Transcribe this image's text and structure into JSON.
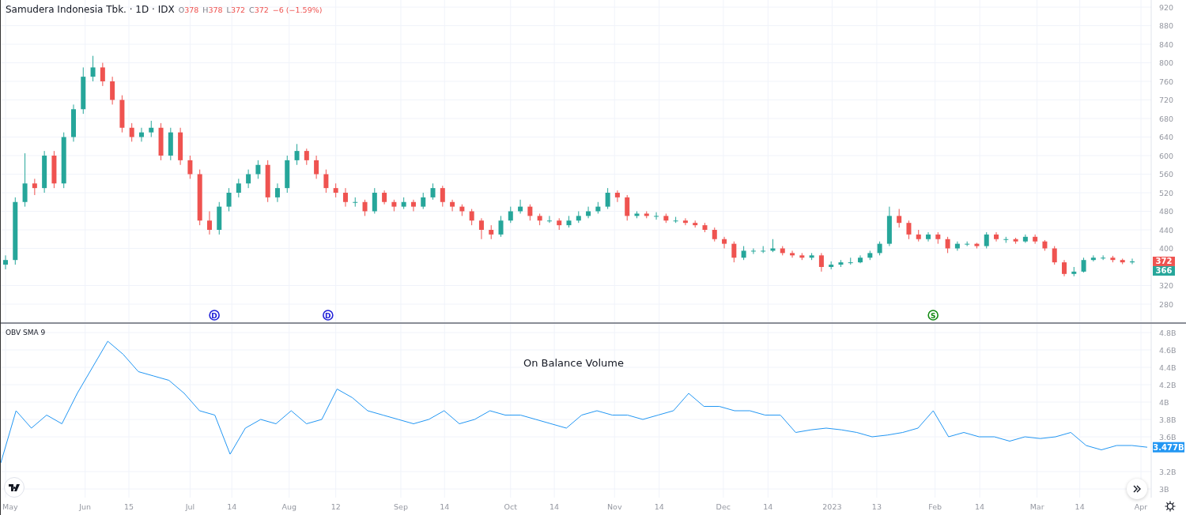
{
  "header": {
    "title": "Samudera Indonesia Tbk. · 1D · IDX",
    "ohlc": [
      {
        "label": "O",
        "value": "378"
      },
      {
        "label": "H",
        "value": "378"
      },
      {
        "label": "L",
        "value": "372"
      },
      {
        "label": "C",
        "value": "372"
      }
    ],
    "change": "−6 (−1.59%)"
  },
  "price_chart": {
    "chart_data": {
      "type": "candlestick",
      "grid": true,
      "ylim": [
        280,
        920
      ],
      "yticks": [
        280,
        320,
        400,
        440,
        480,
        520,
        560,
        600,
        640,
        680,
        720,
        760,
        800,
        840,
        880,
        920
      ],
      "ohlc": [
        [
          365,
          385,
          355,
          375
        ],
        [
          375,
          510,
          365,
          500
        ],
        [
          500,
          605,
          490,
          540
        ],
        [
          540,
          550,
          515,
          530
        ],
        [
          530,
          610,
          520,
          600
        ],
        [
          600,
          610,
          530,
          540
        ],
        [
          540,
          650,
          530,
          640
        ],
        [
          640,
          710,
          630,
          700
        ],
        [
          700,
          790,
          690,
          770
        ],
        [
          770,
          815,
          760,
          790
        ],
        [
          790,
          800,
          750,
          760
        ],
        [
          760,
          770,
          710,
          720
        ],
        [
          720,
          730,
          650,
          660
        ],
        [
          660,
          670,
          630,
          640
        ],
        [
          640,
          660,
          630,
          650
        ],
        [
          650,
          675,
          640,
          660
        ],
        [
          660,
          670,
          590,
          600
        ],
        [
          600,
          660,
          590,
          650
        ],
        [
          650,
          660,
          580,
          590
        ],
        [
          590,
          600,
          550,
          560
        ],
        [
          560,
          570,
          450,
          460
        ],
        [
          460,
          480,
          430,
          440
        ],
        [
          440,
          500,
          430,
          490
        ],
        [
          490,
          530,
          480,
          520
        ],
        [
          520,
          550,
          510,
          540
        ],
        [
          540,
          570,
          530,
          560
        ],
        [
          560,
          590,
          550,
          580
        ],
        [
          580,
          590,
          500,
          510
        ],
        [
          510,
          540,
          500,
          530
        ],
        [
          530,
          600,
          520,
          590
        ],
        [
          590,
          625,
          580,
          610
        ],
        [
          610,
          615,
          580,
          590
        ],
        [
          590,
          600,
          550,
          560
        ],
        [
          560,
          570,
          520,
          530
        ],
        [
          530,
          540,
          510,
          520
        ],
        [
          520,
          530,
          490,
          500
        ],
        [
          500,
          510,
          490,
          500
        ],
        [
          500,
          505,
          470,
          480
        ],
        [
          480,
          530,
          475,
          520
        ],
        [
          520,
          525,
          495,
          500
        ],
        [
          500,
          505,
          480,
          490
        ],
        [
          490,
          510,
          485,
          500
        ],
        [
          500,
          505,
          480,
          490
        ],
        [
          490,
          520,
          485,
          510
        ],
        [
          510,
          540,
          505,
          530
        ],
        [
          530,
          535,
          490,
          500
        ],
        [
          500,
          505,
          480,
          490
        ],
        [
          490,
          495,
          470,
          480
        ],
        [
          480,
          485,
          450,
          460
        ],
        [
          460,
          465,
          420,
          440
        ],
        [
          440,
          450,
          420,
          430
        ],
        [
          430,
          470,
          425,
          460
        ],
        [
          460,
          490,
          455,
          480
        ],
        [
          480,
          505,
          475,
          490
        ],
        [
          490,
          495,
          460,
          470
        ],
        [
          470,
          475,
          450,
          460
        ],
        [
          460,
          470,
          455,
          460
        ],
        [
          460,
          465,
          440,
          450
        ],
        [
          450,
          470,
          445,
          460
        ],
        [
          460,
          480,
          455,
          470
        ],
        [
          470,
          490,
          465,
          480
        ],
        [
          480,
          500,
          475,
          490
        ],
        [
          490,
          530,
          485,
          520
        ],
        [
          520,
          525,
          500,
          510
        ],
        [
          510,
          515,
          460,
          470
        ],
        [
          470,
          480,
          465,
          475
        ],
        [
          475,
          480,
          465,
          470
        ],
        [
          470,
          478,
          462,
          470
        ],
        [
          470,
          475,
          455,
          460
        ],
        [
          460,
          468,
          455,
          460
        ],
        [
          460,
          465,
          450,
          455
        ],
        [
          455,
          460,
          445,
          450
        ],
        [
          450,
          455,
          435,
          440
        ],
        [
          440,
          445,
          415,
          420
        ],
        [
          420,
          425,
          400,
          410
        ],
        [
          410,
          415,
          370,
          380
        ],
        [
          380,
          405,
          375,
          395
        ],
        [
          395,
          400,
          388,
          395
        ],
        [
          395,
          405,
          390,
          395
        ],
        [
          395,
          420,
          392,
          400
        ],
        [
          400,
          405,
          385,
          390
        ],
        [
          390,
          395,
          380,
          385
        ],
        [
          385,
          390,
          375,
          380
        ],
        [
          380,
          390,
          375,
          385
        ],
        [
          385,
          390,
          350,
          360
        ],
        [
          360,
          372,
          355,
          365
        ],
        [
          365,
          375,
          360,
          370
        ],
        [
          370,
          380,
          365,
          370
        ],
        [
          370,
          385,
          368,
          380
        ],
        [
          380,
          395,
          375,
          390
        ],
        [
          390,
          415,
          385,
          410
        ],
        [
          410,
          490,
          405,
          470
        ],
        [
          470,
          485,
          445,
          455
        ],
        [
          455,
          460,
          420,
          430
        ],
        [
          430,
          440,
          415,
          420
        ],
        [
          420,
          435,
          415,
          430
        ],
        [
          430,
          435,
          410,
          420
        ],
        [
          420,
          425,
          390,
          400
        ],
        [
          400,
          415,
          395,
          410
        ],
        [
          410,
          415,
          405,
          410
        ],
        [
          410,
          412,
          400,
          405
        ],
        [
          405,
          435,
          400,
          430
        ],
        [
          430,
          435,
          415,
          420
        ],
        [
          420,
          425,
          412,
          420
        ],
        [
          420,
          423,
          410,
          415
        ],
        [
          415,
          430,
          412,
          425
        ],
        [
          425,
          430,
          410,
          415
        ],
        [
          415,
          418,
          395,
          400
        ],
        [
          400,
          405,
          365,
          370
        ],
        [
          370,
          375,
          340,
          345
        ],
        [
          345,
          360,
          340,
          350
        ],
        [
          350,
          380,
          348,
          375
        ],
        [
          375,
          385,
          372,
          380
        ],
        [
          380,
          385,
          375,
          380
        ],
        [
          380,
          384,
          370,
          375
        ],
        [
          375,
          378,
          366,
          370
        ],
        [
          370,
          378,
          366,
          372
        ]
      ]
    },
    "last_price": "372",
    "prev_price": "366",
    "events": [
      {
        "label": "D",
        "color": "#2121d8"
      },
      {
        "label": "D",
        "color": "#2121d8"
      },
      {
        "label": "S",
        "color": "#138a13"
      }
    ]
  },
  "time_axis": {
    "labels": [
      "May",
      "Jun",
      "15",
      "Jul",
      "14",
      "Aug",
      "12",
      "Sep",
      "14",
      "Oct",
      "14",
      "Nov",
      "14",
      "Dec",
      "14",
      "2023",
      "13",
      "Feb",
      "14",
      "Mar",
      "14",
      "Apr"
    ]
  },
  "indicator": {
    "title": "OBV SMA 9",
    "caption": "On Balance Volume",
    "last_value": "3.477B",
    "chart_data": {
      "type": "line",
      "grid": true,
      "ylim": [
        2.9,
        4.9
      ],
      "yticks": [
        {
          "value": 3,
          "label": "3B"
        },
        {
          "value": 3.2,
          "label": "3.2B"
        },
        {
          "value": 3.6,
          "label": "3.6B"
        },
        {
          "value": 3.8,
          "label": "3.8B"
        },
        {
          "value": 4,
          "label": "4B"
        },
        {
          "value": 4.2,
          "label": "4.2B"
        },
        {
          "value": 4.4,
          "label": "4.4B"
        },
        {
          "value": 4.6,
          "label": "4.6B"
        },
        {
          "value": 4.8,
          "label": "4.8B"
        }
      ],
      "series": [
        {
          "color": "#2196f3",
          "values": [
            3.3,
            3.9,
            3.7,
            3.85,
            3.75,
            4.1,
            4.4,
            4.7,
            4.55,
            4.35,
            4.3,
            4.25,
            4.1,
            3.9,
            3.85,
            3.4,
            3.7,
            3.8,
            3.75,
            3.9,
            3.75,
            3.8,
            4.15,
            4.05,
            3.9,
            3.85,
            3.8,
            3.75,
            3.8,
            3.9,
            3.75,
            3.8,
            3.9,
            3.85,
            3.85,
            3.8,
            3.75,
            3.7,
            3.85,
            3.9,
            3.85,
            3.85,
            3.8,
            3.85,
            3.9,
            4.1,
            3.95,
            3.95,
            3.9,
            3.9,
            3.85,
            3.85,
            3.65,
            3.68,
            3.7,
            3.68,
            3.65,
            3.6,
            3.62,
            3.65,
            3.7,
            3.9,
            3.6,
            3.65,
            3.6,
            3.6,
            3.55,
            3.6,
            3.58,
            3.6,
            3.65,
            3.5,
            3.45,
            3.5,
            3.5,
            3.48
          ]
        }
      ]
    }
  }
}
